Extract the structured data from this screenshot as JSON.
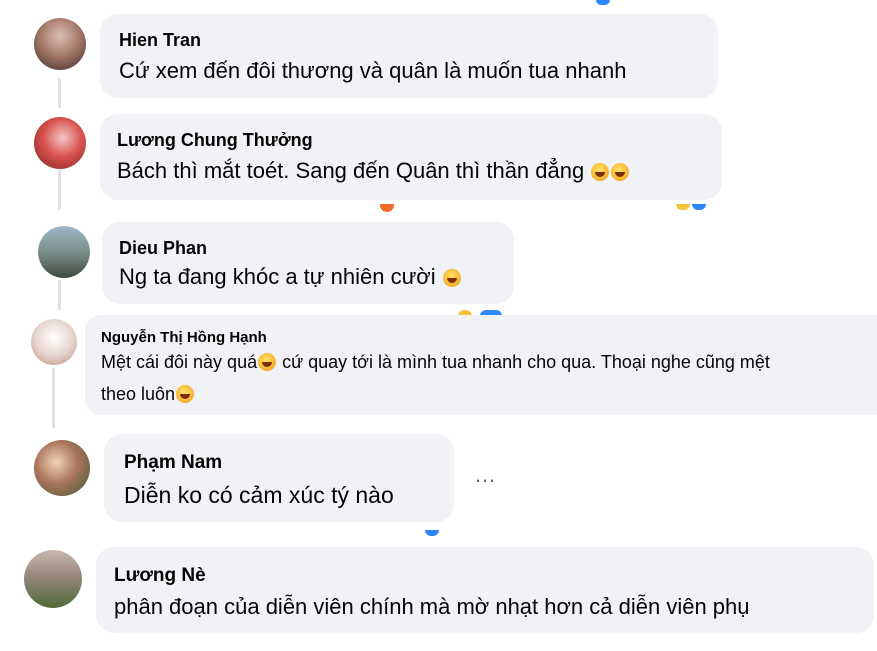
{
  "comments": [
    {
      "author": "Hien Tran",
      "text": "Cứ xem đến đôi thương và quân là muốn tua nhanh"
    },
    {
      "author": "Lương Chung Thưởng",
      "text": "Bách thì mắt toét. Sang đến Quân thì thần đẳng"
    },
    {
      "author": "Dieu Phan",
      "text": "Ng ta đang khóc a tự nhiên cười"
    },
    {
      "author": "Nguyễn Thị Hồng Hạnh",
      "text_line1": "Mệt cái đôi này quá",
      "text_line1b": " cứ quay tới là mình tua nhanh cho qua. Thoại nghe cũng mệt",
      "text_line2": "theo luôn"
    },
    {
      "author": "Phạm Nam",
      "text": "Diễn ko có cảm xúc tý nào"
    },
    {
      "author": "Lương Nè",
      "text": "phân đoạn của diễn viên chính mà mờ nhạt hơn cả diễn viên phụ"
    }
  ],
  "more_label": "…",
  "colors": {
    "bubble": "#f0f2f5",
    "text": "#050505",
    "muted": "#65676b"
  }
}
